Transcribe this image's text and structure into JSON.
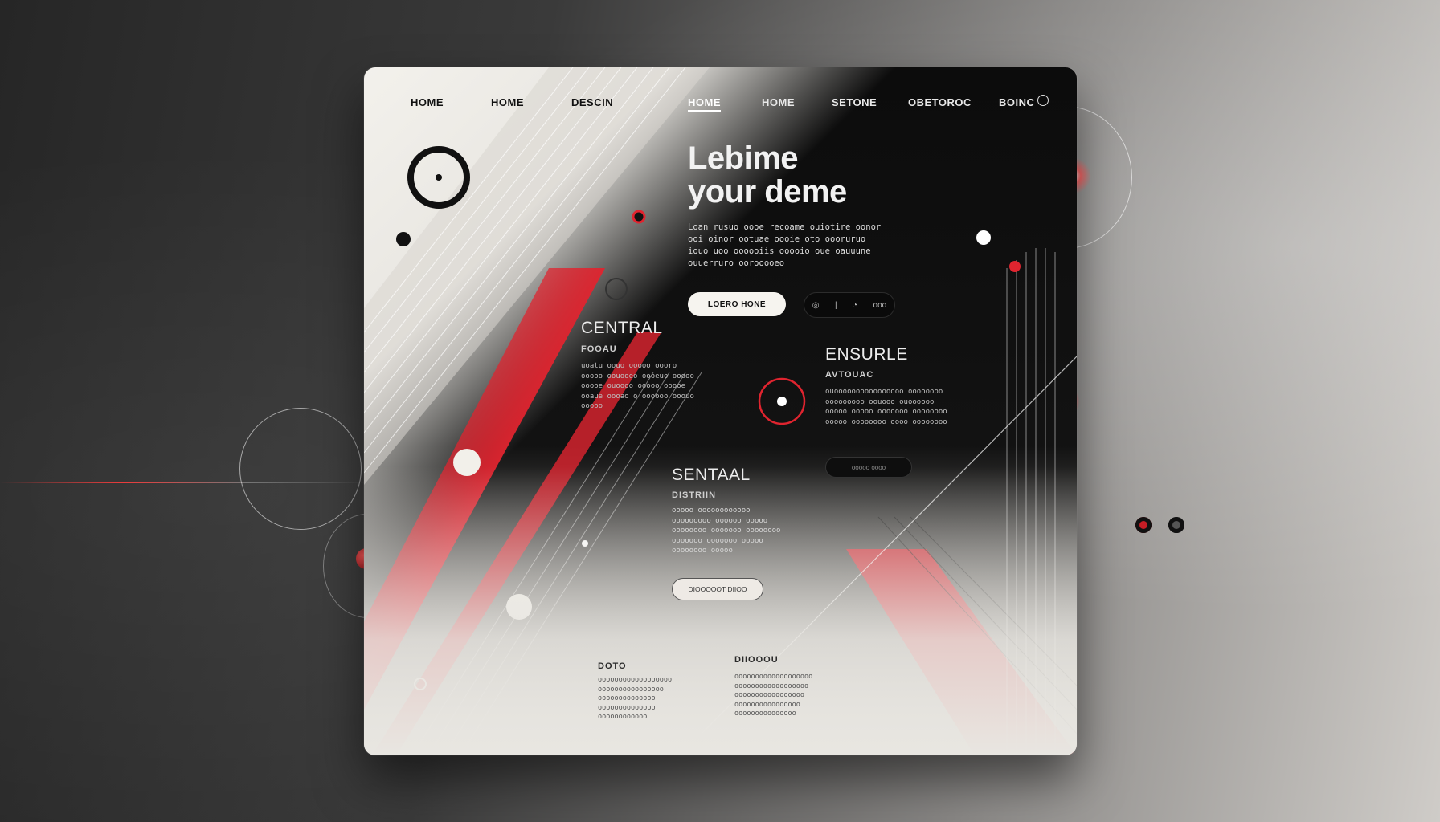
{
  "nav": {
    "items": [
      "HOME",
      "HOME",
      "DESCIN",
      "HOME",
      "HOME",
      "SETONE",
      "OBETOROC",
      "BOINC"
    ],
    "active_index": 3
  },
  "hero": {
    "title_line1": "Lebime",
    "title_line2": "your deme",
    "body": "Loan rusuo oooe recoame ouiotire oonor ooi oinor ootuae oooie oto oooruruo iouo uoo oooooiis ooooio oue oauuune ouuerruro oorooooeo",
    "primary_button": "LOERO HONE",
    "control_1": "◎",
    "control_2": "|",
    "control_3": "◔",
    "control_4": "ooo"
  },
  "sections": {
    "central": {
      "title": "CENTRAL",
      "subtitle": "FOOAU",
      "body": "uoatu oouo ooooo oooro ooooo oouooeo oooeuo ooooo ooooe ouoooo ooooo ooooe ooaue oooao o oooooo ooouo ooooo"
    },
    "ensure": {
      "title": "ENSURLE",
      "subtitle": "AVTOUAC",
      "body": "ouoooooooooooooooo oooooooo ooooooooo oouooo ouoooooo ooooo ooooo ooooooo oooooooo ooooo oooooooo oooo oooooooo",
      "button": "ooooo oooo"
    },
    "sentaal": {
      "title": "SENTAAL",
      "subtitle": "DISTRIIN",
      "body": "ooooo oooooooooooo ooooooooo oooooo ooooo oooooooo ooooooo oooooooo ooooooo ooooooo ooooo oooooooo ooooo",
      "button": "DIOOOOOT DIIOO"
    }
  },
  "footer": {
    "col1_title": "DOTO",
    "col1_body": "oooooooooooooooooo oooooooooooooooo oooooooooooooo oooooooooooooo oooooooooooo",
    "col2_title": "DIIOOOU",
    "col2_body": "ooooooooooooooooooo oooooooooooooooooo ooooooooooooooooo oooooooooooooooo ooooooooooooooo"
  },
  "colors": {
    "accent": "#e0242f",
    "dark": "#0c0c0c",
    "light": "#f3f1ec"
  }
}
